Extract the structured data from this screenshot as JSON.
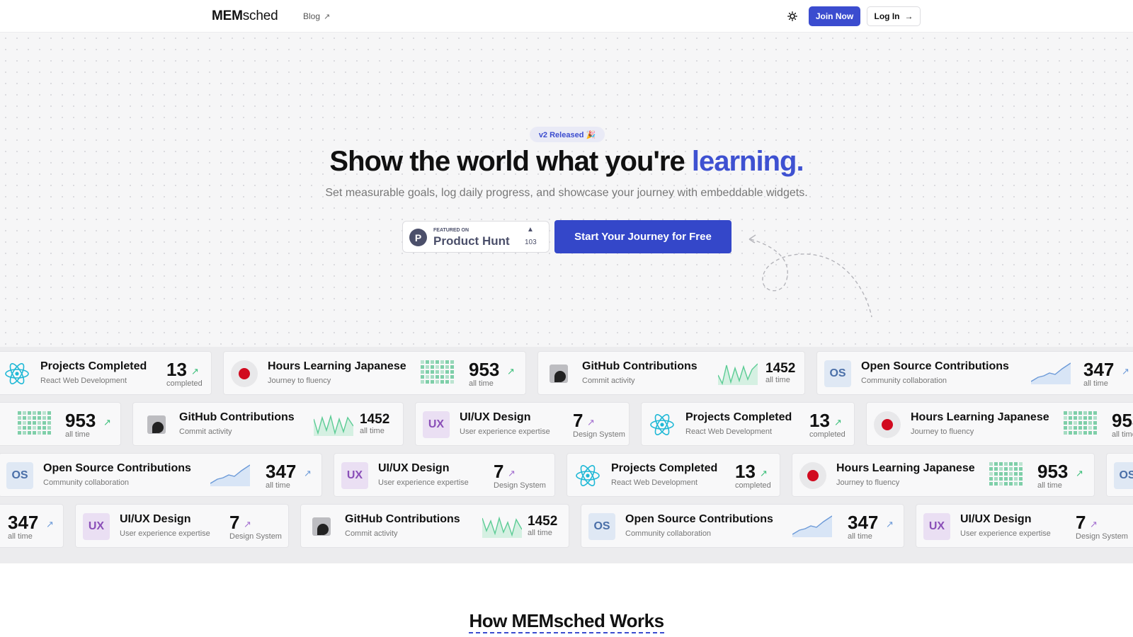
{
  "nav": {
    "logo_bold": "MEM",
    "logo_rest": "sched",
    "blog_label": "Blog",
    "blog_arrow": "↗",
    "theme_icon": "sun-icon",
    "join_label": "Join Now",
    "login_label": "Log In",
    "login_arrow": "→"
  },
  "hero": {
    "badge": "v2 Released 🎉",
    "headline_main": "Show the world what you're ",
    "headline_accent": "learning.",
    "subline": "Set measurable goals, log daily progress, and showcase your journey with embeddable widgets.",
    "product_hunt": {
      "letter": "P",
      "featured": "FEATURED ON",
      "name": "Product Hunt",
      "upvote": "▲",
      "count": "103"
    },
    "cta_label": "Start Your Journey for Free"
  },
  "widgets": {
    "projects": {
      "title": "Projects Completed",
      "subtitle": "React Web Development",
      "value": "13",
      "unit": "completed",
      "icon": "react-icon"
    },
    "japanese": {
      "title": "Hours Learning Japanese",
      "subtitle": "Journey to fluency",
      "value": "953",
      "unit": "all time",
      "icon": "japan-flag-icon"
    },
    "github": {
      "title": "GitHub Contributions",
      "subtitle": "Commit activity",
      "value": "1452",
      "unit": "all time",
      "icon": "github-icon"
    },
    "opensource": {
      "title": "Open Source Contributions",
      "subtitle": "Community collaboration",
      "value": "347",
      "unit": "all time",
      "icon_text": "OS"
    },
    "uxdesign": {
      "title": "UI/UX Design",
      "subtitle": "User experience expertise",
      "value": "7",
      "unit": "Design System",
      "icon_text": "UX"
    },
    "trend": "↗"
  },
  "how": {
    "title": "How MEMsched Works"
  }
}
